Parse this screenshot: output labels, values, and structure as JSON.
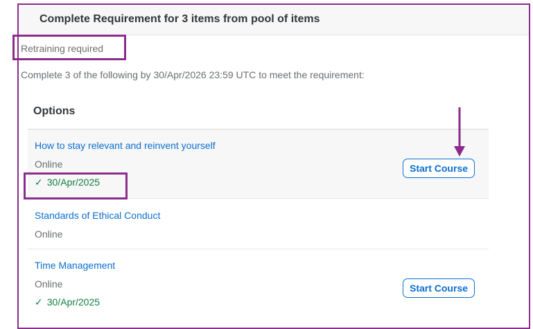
{
  "header": {
    "title": "Complete Requirement for 3 items from pool of items"
  },
  "requirement": {
    "status": "Retraining required",
    "instructions": "Complete 3 of the following by 30/Apr/2026 23:59 UTC to meet the requirement:"
  },
  "options": {
    "heading": "Options",
    "items": [
      {
        "title": "How to stay relevant and reinvent yourself",
        "type": "Online",
        "completed_date": "30/Apr/2025",
        "action_label": "Start Course"
      },
      {
        "title": "Standards of Ethical Conduct",
        "type": "Online"
      },
      {
        "title": "Time Management",
        "type": "Online",
        "completed_date": "30/Apr/2025",
        "action_label": "Start Course"
      }
    ]
  },
  "icons": {
    "check": "check-icon",
    "arrow": "down-arrow-icon"
  },
  "colors": {
    "highlight": "#8b2b8b",
    "link": "#0a6ed1",
    "success": "#107e3e",
    "muted_text": "#6a6d70"
  }
}
